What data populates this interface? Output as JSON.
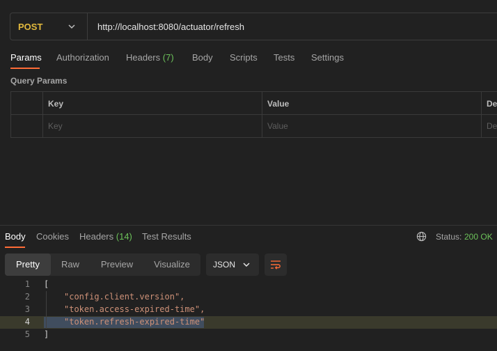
{
  "request": {
    "method": "POST",
    "url": "http://localhost:8080/actuator/refresh",
    "tabs": [
      {
        "label": "Params",
        "count": ""
      },
      {
        "label": "Authorization",
        "count": ""
      },
      {
        "label": "Headers",
        "count": "(7)"
      },
      {
        "label": "Body",
        "count": ""
      },
      {
        "label": "Scripts",
        "count": ""
      },
      {
        "label": "Tests",
        "count": ""
      },
      {
        "label": "Settings",
        "count": ""
      }
    ],
    "active_tab": "Params"
  },
  "query_params": {
    "title": "Query Params",
    "columns": [
      "Key",
      "Value",
      "De"
    ],
    "placeholders": [
      "Key",
      "Value",
      "De"
    ]
  },
  "response": {
    "tabs": [
      {
        "label": "Body",
        "count": ""
      },
      {
        "label": "Cookies",
        "count": ""
      },
      {
        "label": "Headers",
        "count": "(14)"
      },
      {
        "label": "Test Results",
        "count": ""
      }
    ],
    "active_tab": "Body",
    "status_label": "Status:",
    "status_value": "200 OK",
    "views": [
      "Pretty",
      "Raw",
      "Preview",
      "Visualize"
    ],
    "active_view": "Pretty",
    "format": "JSON",
    "code_lines": [
      {
        "num": "1",
        "text": "["
      },
      {
        "num": "2",
        "text": "\"config.client.version\","
      },
      {
        "num": "3",
        "text": "\"token.access-expired-time\","
      },
      {
        "num": "4",
        "text": "\"token.refresh-expired-time\""
      },
      {
        "num": "5",
        "text": "]"
      }
    ],
    "current_line": "4"
  },
  "colors": {
    "accent": "#ff6c37",
    "method": "#e2b93d",
    "status_ok": "#6cc25a",
    "string": "#ce9178"
  },
  "icons": [
    "chevron-down-icon",
    "globe-icon",
    "wrap-lines-icon"
  ]
}
